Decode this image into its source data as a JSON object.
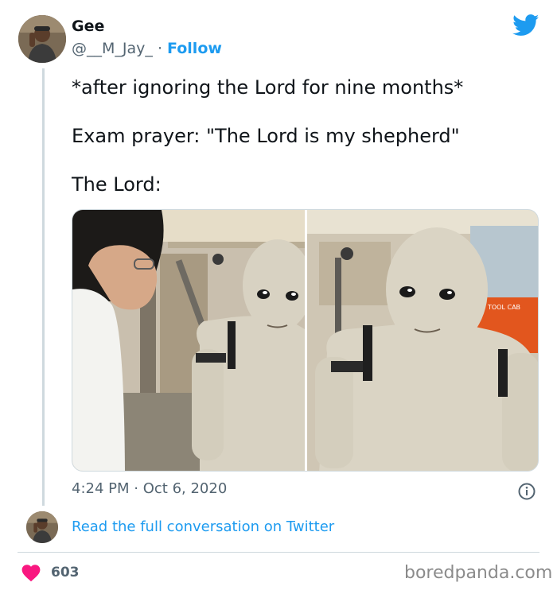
{
  "author": {
    "name": "Gee",
    "handle": "@__M_Jay_",
    "separator": "·",
    "follow_label": "Follow"
  },
  "tweet": {
    "lines": [
      "*after ignoring the Lord for nine months*",
      "Exam prayer: \"The Lord is my shepherd\"",
      "The Lord:"
    ]
  },
  "media": {
    "description_icon": "photo-pair",
    "sign_text": "TOOL CAB"
  },
  "meta": {
    "time": "4:24 PM",
    "separator": "·",
    "date": "Oct 6, 2020"
  },
  "conversation": {
    "link_text": "Read the full conversation on Twitter"
  },
  "engagement": {
    "likes": "603"
  },
  "watermark": "boredpanda.com",
  "colors": {
    "twitter_blue": "#1d9bf0",
    "heart": "#f91880",
    "text": "#0f1419",
    "muted": "#536471"
  },
  "icons": [
    "twitter-bird-icon",
    "info-icon",
    "heart-icon"
  ]
}
